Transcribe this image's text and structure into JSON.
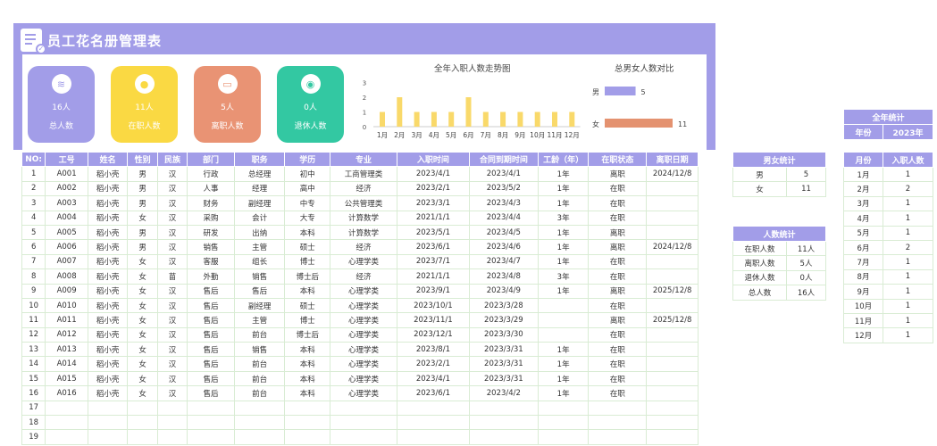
{
  "title": "员工花名册管理表",
  "colors": {
    "accent": "#a29de8",
    "yellow": "#fad943",
    "orange": "#e99374",
    "teal": "#33c8a2",
    "bar_yellow": "#f9d96a",
    "bar_orange": "#e49270"
  },
  "kpis": [
    {
      "icon": "layers-icon",
      "value": "16人",
      "label": "总人数",
      "color": "#a29de8"
    },
    {
      "icon": "user-icon",
      "value": "11人",
      "label": "在职人数",
      "color": "#fad943"
    },
    {
      "icon": "id-card-icon",
      "value": "5人",
      "label": "离职人数",
      "color": "#e99374"
    },
    {
      "icon": "group-icon",
      "value": "0人",
      "label": "退休人数",
      "color": "#33c8a2"
    }
  ],
  "chart_data": [
    {
      "type": "bar",
      "title": "全年入职人数走势图",
      "categories": [
        "1月",
        "2月",
        "3月",
        "4月",
        "5月",
        "6月",
        "7月",
        "8月",
        "9月",
        "10月",
        "11月",
        "12月"
      ],
      "values": [
        1,
        2,
        1,
        1,
        1,
        2,
        1,
        1,
        1,
        1,
        1,
        1
      ],
      "yticks": [
        "0",
        "1",
        "2",
        "3"
      ],
      "ylim": [
        0,
        3
      ]
    },
    {
      "type": "bar",
      "orientation": "horizontal",
      "title": "总男女人数对比",
      "categories": [
        "男",
        "女"
      ],
      "values": [
        5,
        11
      ]
    }
  ],
  "table": {
    "headers": [
      "NO:",
      "工号",
      "姓名",
      "性别",
      "民族",
      "部门",
      "职务",
      "学历",
      "专业",
      "入职时间",
      "合同到期时间",
      "工龄（年）",
      "在职状态",
      "离职日期"
    ],
    "rows": [
      [
        "1",
        "A001",
        "稻小壳",
        "男",
        "汉",
        "行政",
        "总经理",
        "初中",
        "工商管理类",
        "2023/4/1",
        "2023/4/1",
        "1年",
        "离职",
        "2024/12/8"
      ],
      [
        "2",
        "A002",
        "稻小壳",
        "男",
        "汉",
        "人事",
        "经理",
        "高中",
        "经济",
        "2023/2/1",
        "2023/5/2",
        "1年",
        "在职",
        ""
      ],
      [
        "3",
        "A003",
        "稻小壳",
        "男",
        "汉",
        "财务",
        "副经理",
        "中专",
        "公共管理类",
        "2023/3/1",
        "2023/4/3",
        "1年",
        "在职",
        ""
      ],
      [
        "4",
        "A004",
        "稻小壳",
        "女",
        "汉",
        "采购",
        "会计",
        "大专",
        "计算数学",
        "2021/1/1",
        "2023/4/4",
        "3年",
        "在职",
        ""
      ],
      [
        "5",
        "A005",
        "稻小壳",
        "男",
        "汉",
        "研发",
        "出纳",
        "本科",
        "计算数学",
        "2023/5/1",
        "2023/4/5",
        "1年",
        "离职",
        ""
      ],
      [
        "6",
        "A006",
        "稻小壳",
        "男",
        "汉",
        "销售",
        "主管",
        "硕士",
        "经济",
        "2023/6/1",
        "2023/4/6",
        "1年",
        "离职",
        "2024/12/8"
      ],
      [
        "7",
        "A007",
        "稻小壳",
        "女",
        "汉",
        "客服",
        "组长",
        "博士",
        "心理学类",
        "2023/7/1",
        "2023/4/7",
        "1年",
        "在职",
        ""
      ],
      [
        "8",
        "A008",
        "稻小壳",
        "女",
        "苗",
        "外勤",
        "销售",
        "博士后",
        "经济",
        "2021/1/1",
        "2023/4/8",
        "3年",
        "在职",
        ""
      ],
      [
        "9",
        "A009",
        "稻小壳",
        "女",
        "汉",
        "售后",
        "售后",
        "本科",
        "心理学类",
        "2023/9/1",
        "2023/4/9",
        "1年",
        "离职",
        "2025/12/8"
      ],
      [
        "10",
        "A010",
        "稻小壳",
        "女",
        "汉",
        "售后",
        "副经理",
        "硕士",
        "心理学类",
        "2023/10/1",
        "2023/3/28",
        "",
        "在职",
        ""
      ],
      [
        "11",
        "A011",
        "稻小壳",
        "女",
        "汉",
        "售后",
        "主管",
        "博士",
        "心理学类",
        "2023/11/1",
        "2023/3/29",
        "",
        "离职",
        "2025/12/8"
      ],
      [
        "12",
        "A012",
        "稻小壳",
        "女",
        "汉",
        "售后",
        "前台",
        "博士后",
        "心理学类",
        "2023/12/1",
        "2023/3/30",
        "",
        "在职",
        ""
      ],
      [
        "13",
        "A013",
        "稻小壳",
        "女",
        "汉",
        "售后",
        "销售",
        "本科",
        "心理学类",
        "2023/8/1",
        "2023/3/31",
        "1年",
        "在职",
        ""
      ],
      [
        "14",
        "A014",
        "稻小壳",
        "女",
        "汉",
        "售后",
        "前台",
        "本科",
        "心理学类",
        "2023/2/1",
        "2023/3/31",
        "1年",
        "在职",
        ""
      ],
      [
        "15",
        "A015",
        "稻小壳",
        "女",
        "汉",
        "售后",
        "前台",
        "本科",
        "心理学类",
        "2023/4/1",
        "2023/3/31",
        "1年",
        "在职",
        ""
      ],
      [
        "16",
        "A016",
        "稻小壳",
        "女",
        "汉",
        "售后",
        "前台",
        "本科",
        "心理学类",
        "2023/6/1",
        "2023/4/2",
        "1年",
        "在职",
        ""
      ],
      [
        "17",
        "",
        "",
        "",
        "",
        "",
        "",
        "",
        "",
        "",
        "",
        "",
        "",
        ""
      ],
      [
        "18",
        "",
        "",
        "",
        "",
        "",
        "",
        "",
        "",
        "",
        "",
        "",
        "",
        ""
      ],
      [
        "19",
        "",
        "",
        "",
        "",
        "",
        "",
        "",
        "",
        "",
        "",
        "",
        "",
        ""
      ]
    ]
  },
  "gender_stats": {
    "title": "男女统计",
    "rows": [
      [
        "男",
        "5"
      ],
      [
        "女",
        "11"
      ]
    ]
  },
  "count_stats": {
    "title": "人数统计",
    "rows": [
      [
        "在职人数",
        "11人"
      ],
      [
        "离职人数",
        "5人"
      ],
      [
        "退休人数",
        "0人"
      ],
      [
        "总人数",
        "16人"
      ]
    ]
  },
  "year_stats": {
    "title": "全年统计",
    "year_label": "年份",
    "year_value": "2023年",
    "col_month": "月份",
    "col_count": "入职人数",
    "rows": [
      [
        "1月",
        "1"
      ],
      [
        "2月",
        "2"
      ],
      [
        "3月",
        "1"
      ],
      [
        "4月",
        "1"
      ],
      [
        "5月",
        "1"
      ],
      [
        "6月",
        "2"
      ],
      [
        "7月",
        "1"
      ],
      [
        "8月",
        "1"
      ],
      [
        "9月",
        "1"
      ],
      [
        "10月",
        "1"
      ],
      [
        "11月",
        "1"
      ],
      [
        "12月",
        "1"
      ]
    ]
  }
}
